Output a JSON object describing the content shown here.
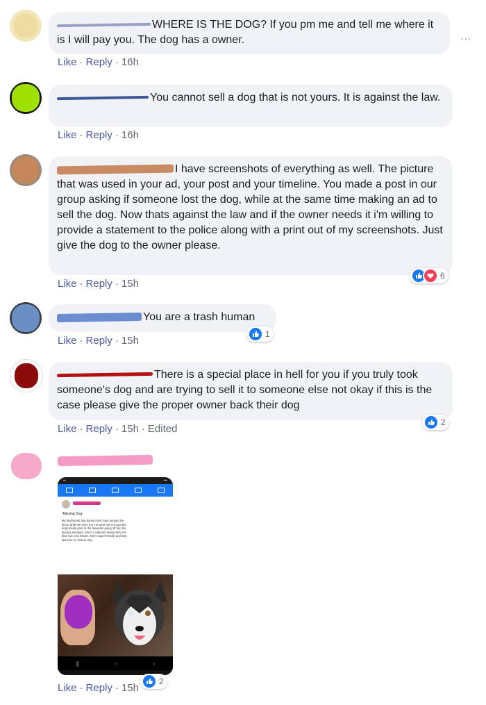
{
  "more_menu": "...",
  "action_labels": {
    "like": "Like",
    "reply": "Reply",
    "sep": "·"
  },
  "comments": [
    {
      "text": "WHERE IS THE DOG? If you pm me and tell me where it is I will pay you. The dog has a owner.",
      "time": "16h"
    },
    {
      "text": "You cannot sell a dog that is not yours. It is against the law.",
      "time": "16h"
    },
    {
      "text": "I have screenshots of everything as well. The picture that was used in your ad, your post and your timeline. You made a post in our group asking if someone lost the dog, while at the same time making an ad to sell the dog. Now thats against the law and if the owner needs it i'm willing to provide a statement to the police along with a print out of my screenshots. Just give the dog to the owner please.",
      "time": "15h",
      "reaction_count": "6"
    },
    {
      "text": "You are a trash human",
      "time": "15h",
      "reaction_count": "1"
    },
    {
      "text": "There is a special place in hell for you if you truly took someone's dog and are trying to sell it to someone else not okay if this is the case please give the proper owner back their dog",
      "time": "15h",
      "edited": "Edited",
      "reaction_count": "2"
    },
    {
      "time": "15h",
      "reaction_count": "2",
      "phone": {
        "post_title": "-Missing Dog-",
        "post_text": "My boyfriends dog Sansa must have jumped the fence while we were out. He went home to put the dogs inside prior to the fireworks going off but she already escaped. She's a Siberian Husky with one blue eye, one brown. She's super friendly and was last seen in Suisun City."
      }
    }
  ],
  "colors": {
    "bubble": "#f0f2f5",
    "link": "#4b5aa3",
    "like_blue": "#1877f2",
    "love_red": "#f33e58"
  }
}
